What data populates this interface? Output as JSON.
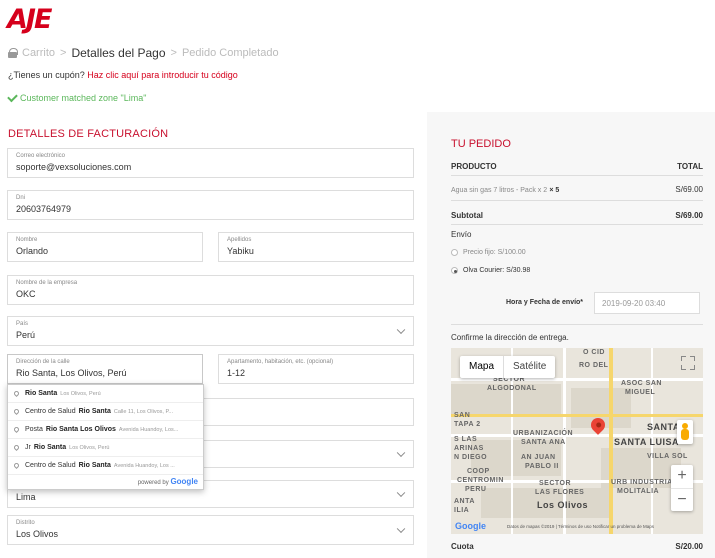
{
  "brand": {
    "logo_text": "AJE",
    "brand_color": "#d6001c"
  },
  "breadcrumb": {
    "step1": "Carrito",
    "step2": "Detalles del Pago",
    "step3": "Pedido Completado",
    "separator": ">"
  },
  "coupon": {
    "question": "¿Tienes un cupón?",
    "link": "Haz clic aquí para introducir tu código"
  },
  "notice": {
    "matched_text": "Customer matched zone \"Lima\""
  },
  "billing": {
    "title": "DETALLES DE FACTURACIÓN",
    "email": {
      "label": "Correo electrónico",
      "value": "soporte@vexsoluciones.com"
    },
    "dni": {
      "label": "Dni",
      "value": "20603764979"
    },
    "first_name": {
      "label": "Nombre",
      "value": "Orlando"
    },
    "last_name": {
      "label": "Apellidos",
      "value": "Yabiku"
    },
    "company": {
      "label": "Nombre de la empresa",
      "value": "OKC"
    },
    "country": {
      "label": "País",
      "value": "Perú"
    },
    "street": {
      "label": "Dirección de la calle",
      "value": "Rio Santa, Los Olivos, Perú"
    },
    "apartment": {
      "label": "Apartamento, habitación, etc. (opcional)",
      "value": "1-12"
    },
    "province": {
      "value": "Lima"
    },
    "district": {
      "label": "Distrito",
      "value": "Los Olivos"
    }
  },
  "autocomplete": {
    "items": [
      {
        "main": "Rio Santa",
        "secondary": "Los Olivos, Perú"
      },
      {
        "prefix": "Centro de Salud",
        "main": "Rio Santa",
        "secondary": "Calle 11, Los Olivos, P..."
      },
      {
        "prefix": "Posta",
        "main": "Rio Santa Los Olivos",
        "secondary": "Avenida Huandoy, Los..."
      },
      {
        "prefix": "Jr",
        "main": "Rio Santa",
        "secondary": "Los Olivos, Perú"
      },
      {
        "prefix": "Centro de Salud",
        "main": "Rio Santa",
        "secondary": "Avenida Huandoy, Los ..."
      }
    ],
    "powered_by": "powered by",
    "google": "Google"
  },
  "order": {
    "title": "TU PEDIDO",
    "col_product": "PRODUCTO",
    "col_total": "TOTAL",
    "item_name": "Agua sin gas 7 litros - Pack x 2",
    "item_qty": "× 5",
    "item_total": "S/69.00",
    "subtotal_label": "Subtotal",
    "subtotal_value": "S/69.00",
    "shipping_label": "Envío",
    "shipping_opt1": "Precio fijo: S/100.00",
    "shipping_opt2": "Olva Courier: S/30.98",
    "datetime_label": "Hora y Fecha de envío*",
    "datetime_value": "2019-09-20 03:40",
    "confirm_label": "Confirme la dirección de entrega.",
    "cuota_label": "Cuota",
    "cuota_value": "S/20.00"
  },
  "map": {
    "tab_map": "Mapa",
    "tab_satellite": "Satélite",
    "labels": [
      "SECTOR",
      "ALGODONAL",
      "ASOC SAN",
      "MIGUEL",
      "SAN",
      "TAPA 2",
      "URBANIZACIÓN",
      "SANTA ANA",
      "SANTA LUISA",
      "SANTA",
      "S LAS",
      "ARINAS",
      "N DIEGO",
      "AN JUAN",
      "PABLO II",
      "VILLA SOL",
      "COOP",
      "CENTROMIN",
      "PERU",
      "SECTOR",
      "LAS FLORES",
      "URB INDUSTRIAL",
      "MOLITALIA",
      "ANTA",
      "Los Olivos",
      "ILIA",
      "O CID",
      "RO DEL"
    ],
    "google": "Google",
    "footer": "Datos de mapas ©2019 | Términos de uso   Notificar un problema de Maps"
  }
}
